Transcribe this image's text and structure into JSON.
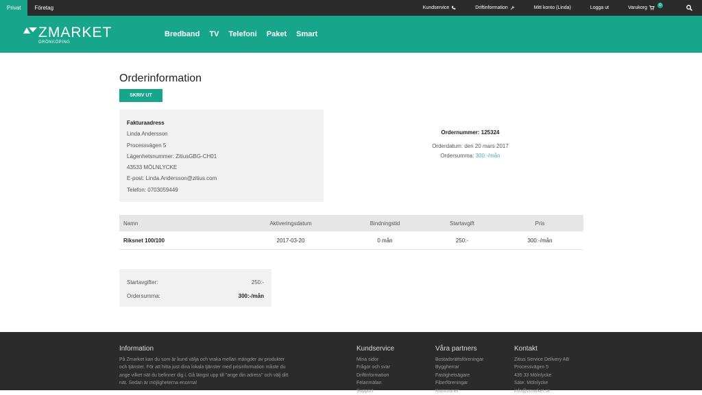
{
  "topbar": {
    "segments": [
      "Privat",
      "Företag"
    ],
    "links": [
      "Kundservice",
      "Driftinformation",
      "Mitt konto (Linda)",
      "Logga ut",
      "Varukorg"
    ],
    "cart_count": "0"
  },
  "header": {
    "logo": "ZMARKET",
    "logo_sub": "GRÖNKÖPING",
    "nav": [
      "Bredband",
      "TV",
      "Telefoni",
      "Paket",
      "Smart"
    ]
  },
  "page": {
    "title": "Orderinformation",
    "print_label": "SKRIV UT"
  },
  "invoice": {
    "title": "Fakturaadress",
    "lines": [
      "Linda Andersson",
      "Processvägen 5",
      "Lägenhetsnummer: ZitiusGBG-CH01",
      "43533 MÖLNLYCKE",
      "E-post: Linda.Andersson@zitius.com",
      "Telefon: 0703059449"
    ]
  },
  "order": {
    "number_label": "Ordernummer: 125324",
    "date_label": "Orderdatum: den 20 mars 2017",
    "sum_label": "Ordersumma:",
    "sum_value": "300:-/mån"
  },
  "table": {
    "headers": [
      "Namn",
      "Aktiveringsdatum",
      "Bindningstid",
      "Startavgift",
      "Pris"
    ],
    "rows": [
      [
        "Riksnet 100/100",
        "2017-03-20",
        "0 mån",
        "250:-",
        "300:-/mån"
      ]
    ]
  },
  "summary": {
    "start_label": "Startavgifter:",
    "start_value": "250:-",
    "total_label": "Ordersumma:",
    "total_value": "300:-/mån"
  },
  "footer": {
    "info_title": "Information",
    "info_text": [
      "På Zmarket kan du som är kund välja och vraka mellan mängder av produkter",
      "och tjänster. För att hitta just dina lokala tjänster med prisinformation måste du",
      "ange vilket nät du befinner dig i. Gå längst upp till \"ange din adress\" och välj ditt",
      "nät. Sedan är möjligheterna enorma!"
    ],
    "kundservice_title": "Kundservice",
    "kundservice_items": [
      "Mina sidor",
      "Frågor och svar",
      "Driftinformation",
      "Felanmälan",
      "Support"
    ],
    "partners_title": "Våra partners",
    "partners_items": [
      "Bostadsrättsföreningar",
      "Byggherrar",
      "Fastighetsägare",
      "Fiberföreningar",
      "Kommuner"
    ],
    "kontakt_title": "Kontakt",
    "kontakt_items": [
      "Zitius Service Delivery AB",
      "Processvägen 5",
      "435 33 Mölnlycke",
      "Säte: Mölnlycke",
      "info@zmarket.se"
    ]
  },
  "colors": {
    "accent": "#17a68c",
    "dark": "#2b2b2b",
    "link": "#4aa8b9"
  },
  "icons": [
    "phone-icon",
    "wrench-icon",
    "cart-icon",
    "search-icon",
    "zmarket-logo-icon"
  ]
}
